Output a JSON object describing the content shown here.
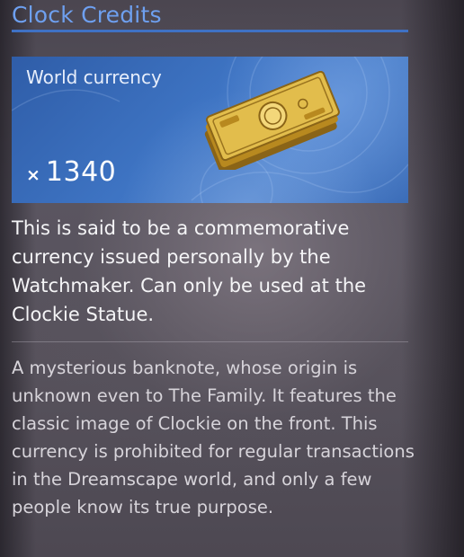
{
  "item": {
    "title": "Clock Credits",
    "category": "World currency",
    "quantity_prefix": "×",
    "quantity": "1340",
    "description": "This is said to be a commemorative currency issued personally by the Watchmaker. Can only be used at the Clockie Statue.",
    "lore": "A mysterious banknote, whose origin is unknown even to The Family. It features the classic image of Clockie on the front. This currency is prohibited for regular transactions in the Dreamscape world, and only a few people know its true purpose.",
    "icon": "banknote-icon"
  },
  "colors": {
    "title": "#6ea0f0",
    "title_rule": "#3f71c4",
    "card_blue": "#3e74c3",
    "gold": "#d9b548"
  }
}
